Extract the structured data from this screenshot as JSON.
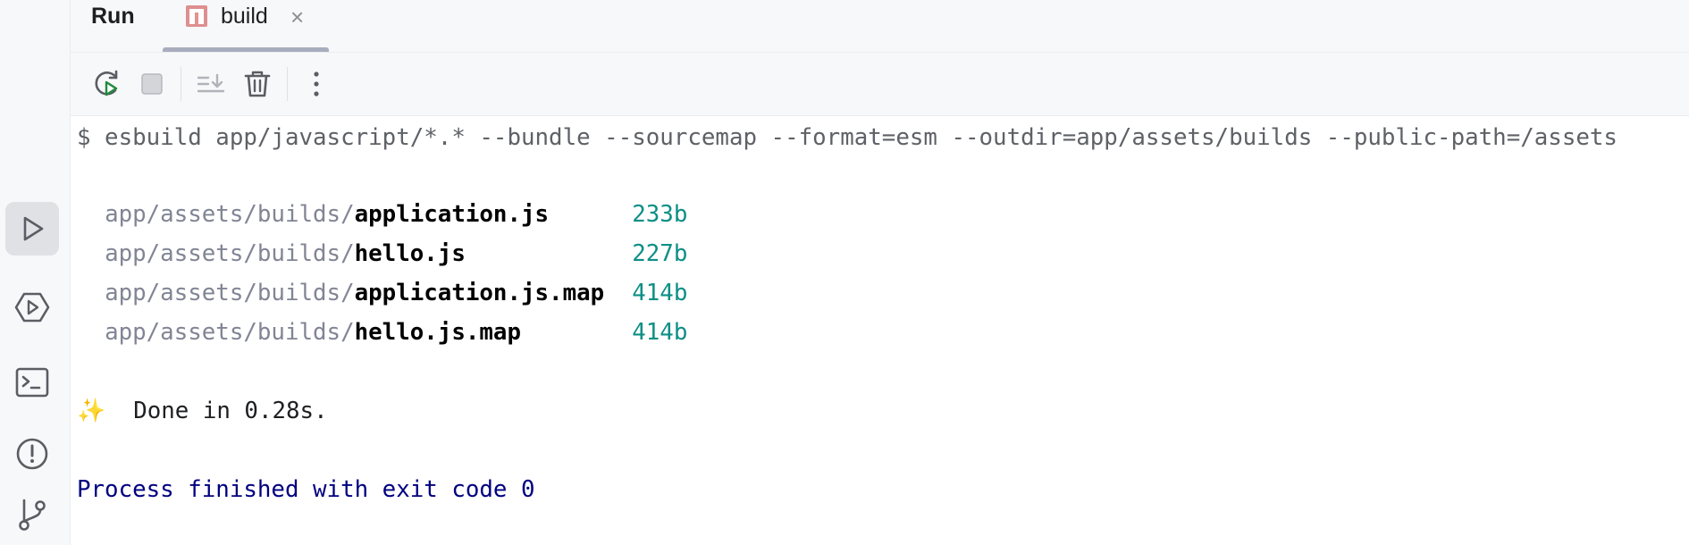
{
  "tabbar": {
    "run_label": "Run",
    "tab": {
      "label": "build",
      "icon": "npm-icon",
      "close_icon": "close-icon",
      "close_glyph": "×"
    }
  },
  "sidebar": {
    "items": [
      {
        "name": "run-icon",
        "active": true
      },
      {
        "name": "services-icon",
        "active": false
      },
      {
        "name": "terminal-icon",
        "active": false
      },
      {
        "name": "problems-icon",
        "active": false
      },
      {
        "name": "git-icon",
        "active": false
      }
    ]
  },
  "toolbar": {
    "buttons": [
      "rerun-icon",
      "stop-icon",
      "scroll-to-end-icon",
      "clear-all-icon",
      "more-options-icon"
    ]
  },
  "console": {
    "command": "$ esbuild app/javascript/*.* --bundle --sourcemap --format=esm --outdir=app/assets/builds --public-path=/assets",
    "files": [
      {
        "dir": "app/assets/builds/",
        "name": "application.js",
        "pad": "      ",
        "size": "233b"
      },
      {
        "dir": "app/assets/builds/",
        "name": "hello.js",
        "pad": "            ",
        "size": "227b"
      },
      {
        "dir": "app/assets/builds/",
        "name": "application.js.map",
        "pad": "  ",
        "size": "414b"
      },
      {
        "dir": "app/assets/builds/",
        "name": "hello.js.map",
        "pad": "        ",
        "size": "414b"
      }
    ],
    "done_emoji": "✨",
    "done_text": "Done in 0.28s.",
    "process_text": "Process finished with exit code 0"
  },
  "colors": {
    "size_accent": "#0d8f86",
    "process_text": "#000080",
    "npm_red": "#cb3837",
    "run_green": "#208a3c"
  }
}
